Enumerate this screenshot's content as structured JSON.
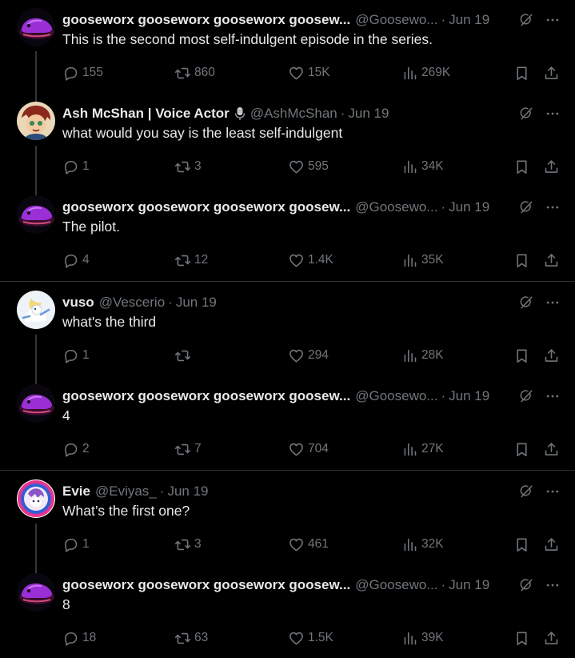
{
  "colors": {
    "background": "#000000",
    "text_primary": "#e7e9ea",
    "text_secondary": "#71767b",
    "divider": "#2f3336"
  },
  "tweets": [
    {
      "name": "gooseworx gooseworx gooseworx goosew...",
      "handle": "@Goosewo...",
      "date": "Jun 19",
      "text": "This is the second most self-indulgent episode in the series.",
      "replies": "155",
      "reposts": "860",
      "likes": "15K",
      "views": "269K"
    },
    {
      "name": "Ash McShan | Voice Actor",
      "handle": "@AshMcShan",
      "date": "Jun 19",
      "text": "what would you say is the least self-indulgent",
      "replies": "1",
      "reposts": "3",
      "likes": "595",
      "views": "34K"
    },
    {
      "name": "gooseworx gooseworx gooseworx goosew...",
      "handle": "@Goosewo...",
      "date": "Jun 19",
      "text": "The pilot.",
      "replies": "4",
      "reposts": "12",
      "likes": "1.4K",
      "views": "35K"
    },
    {
      "name": "vuso",
      "handle": "@Vescerio",
      "date": "Jun 19",
      "text": "what's the third",
      "replies": "1",
      "reposts": "",
      "likes": "294",
      "views": "28K"
    },
    {
      "name": "gooseworx gooseworx gooseworx goosew...",
      "handle": "@Goosewo...",
      "date": "Jun 19",
      "text": "4",
      "replies": "2",
      "reposts": "7",
      "likes": "704",
      "views": "27K"
    },
    {
      "name": "Evie",
      "handle": "@Eviyas_",
      "date": "Jun 19",
      "text": "What’s the first one?",
      "replies": "1",
      "reposts": "3",
      "likes": "461",
      "views": "32K"
    },
    {
      "name": "gooseworx gooseworx gooseworx goosew...",
      "handle": "@Goosewo...",
      "date": "Jun 19",
      "text": "8",
      "replies": "18",
      "reposts": "63",
      "likes": "1.5K",
      "views": "39K"
    }
  ],
  "separator": "·",
  "icons": {
    "reply": "speech-bubble-icon",
    "repost": "repost-arrows-icon",
    "like": "heart-icon",
    "views": "bar-chart-icon",
    "bookmark": "bookmark-icon",
    "share": "share-upload-icon",
    "grok": "grok-slash-circle-icon",
    "more": "more-dots-icon",
    "mic": "microphone-icon"
  }
}
